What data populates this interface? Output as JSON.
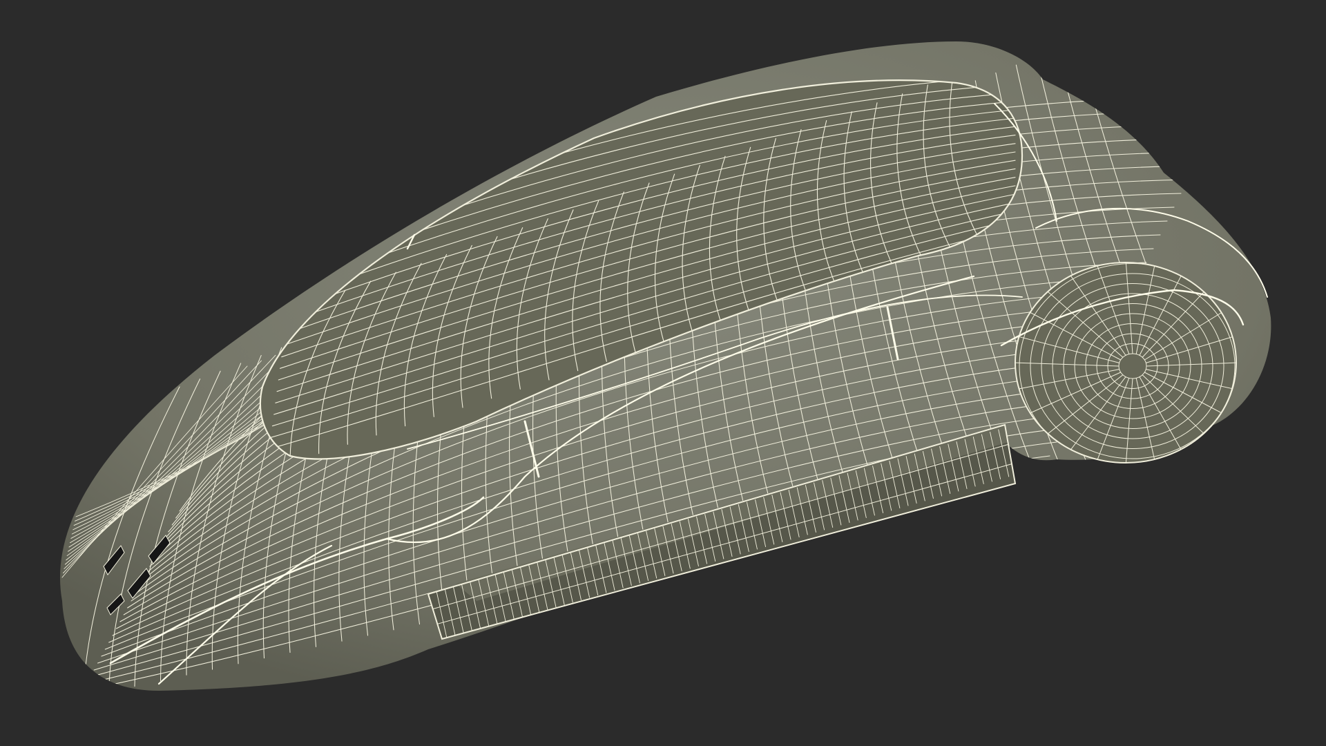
{
  "scene": {
    "background_color": "#2b2b2b",
    "surface_color": "#7b7c6b",
    "surface_shade_color": "#676858",
    "surface_dark_color": "#56574a",
    "wire_color": "#f1efdc",
    "crease_color": "#fffdea",
    "vent_color": "#161616",
    "icons": [
      "wireframe-vehicle-model"
    ]
  }
}
